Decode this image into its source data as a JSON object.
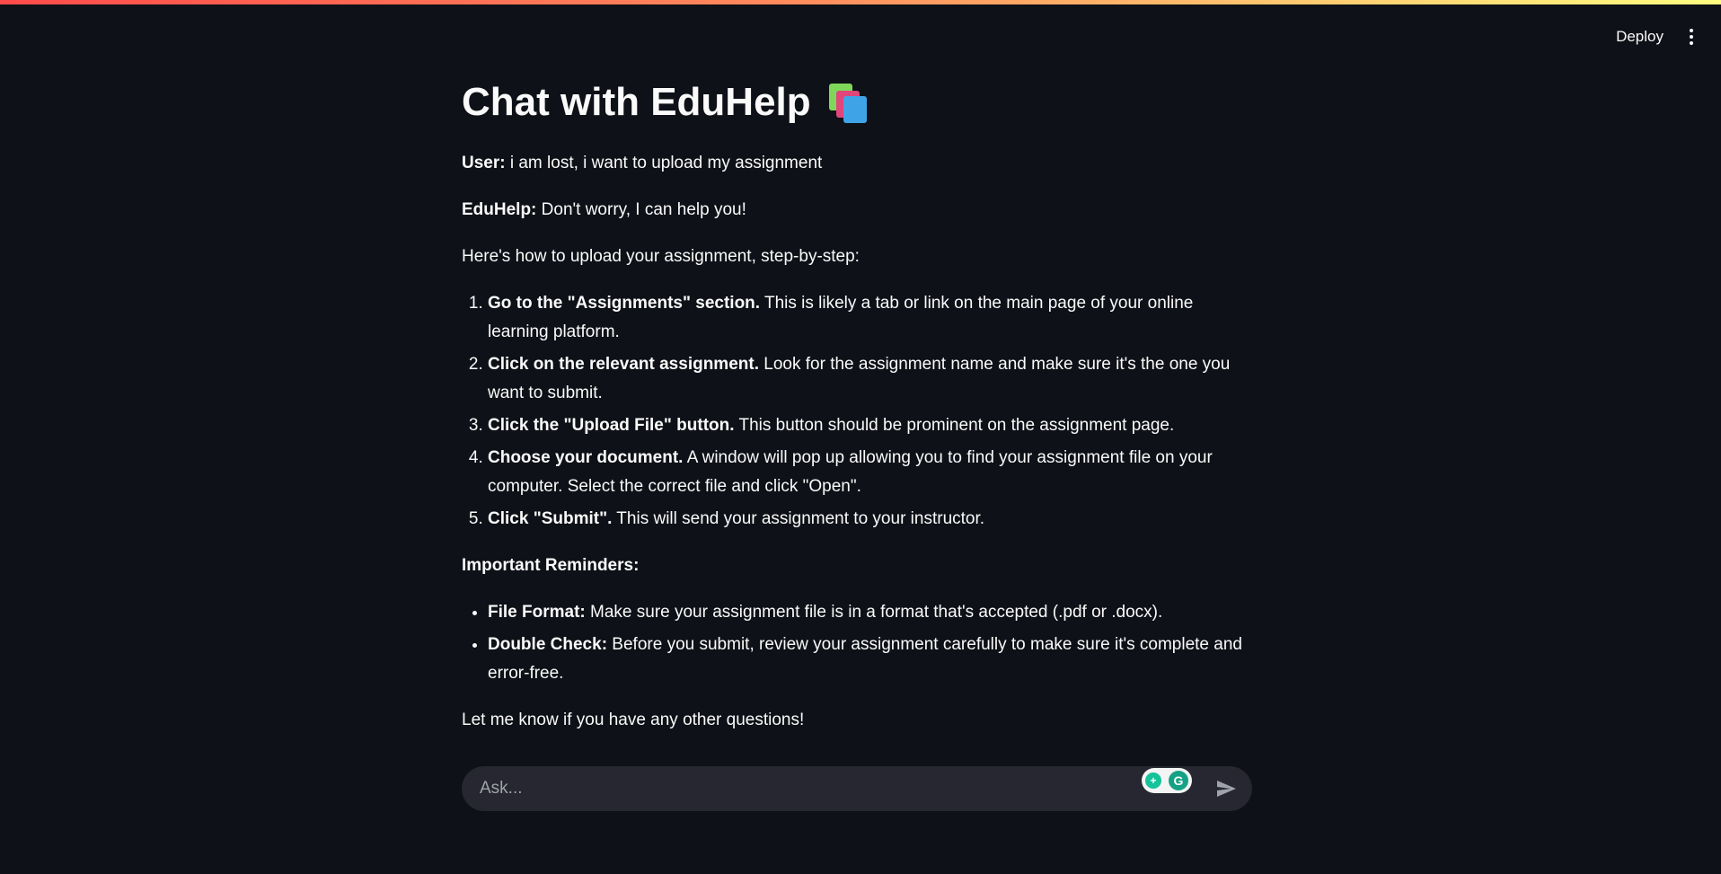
{
  "header": {
    "deploy_label": "Deploy",
    "menu_icon": "kebab-menu-icon"
  },
  "page": {
    "title": "Chat with EduHelp",
    "title_icon": "books-emoji-icon"
  },
  "chat": {
    "user_message": {
      "speaker": "User:",
      "text": " i am lost, i want to upload my assignment"
    },
    "bot_message": {
      "speaker": "EduHelp:",
      "text": " Don't worry, I can help you!",
      "intro": "Here's how to upload your assignment, step-by-step:",
      "steps": [
        {
          "num": "1.",
          "bold": "Go to the \"Assignments\" section.",
          "text": " This is likely a tab or link on the main page of your online learning platform."
        },
        {
          "num": "2.",
          "bold": "Click on the relevant assignment.",
          "text": " Look for the assignment name and make sure it's the one you want to submit."
        },
        {
          "num": "3.",
          "bold": "Click the \"Upload File\" button.",
          "text": " This button should be prominent on the assignment page."
        },
        {
          "num": "4.",
          "bold": "Choose your document.",
          "text": " A window will pop up allowing you to find your assignment file on your computer. Select the correct file and click \"Open\"."
        },
        {
          "num": "5.",
          "bold": "Click \"Submit\".",
          "text": " This will send your assignment to your instructor."
        }
      ],
      "reminders_heading": "Important Reminders:",
      "reminders": [
        {
          "bold": "File Format:",
          "text": " Make sure your assignment file is in a format that's accepted (.pdf or .docx)."
        },
        {
          "bold": "Double Check:",
          "text": " Before you submit, review your assignment carefully to make sure it's complete and error-free."
        }
      ],
      "closing": "Let me know if you have any other questions!"
    }
  },
  "input": {
    "placeholder": "Ask...",
    "value": "",
    "send_icon": "send-arrow-icon",
    "extension_icon": "grammarly-icon"
  },
  "colors": {
    "background": "#0e1117",
    "text": "#fafafa",
    "input_bg": "#262730",
    "accent_gradient_start": "#ff4b4b",
    "accent_gradient_end": "#fffd80"
  }
}
